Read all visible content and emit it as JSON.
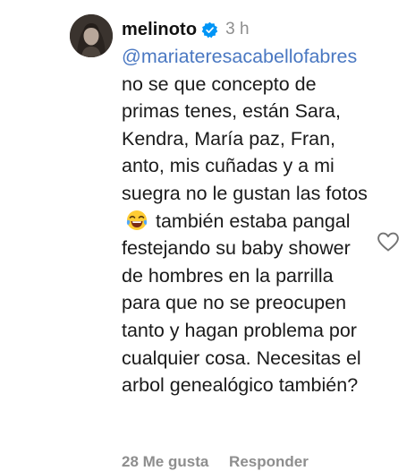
{
  "comment": {
    "username": "melinoto",
    "verified_icon": "verified-badge-icon",
    "time": "3 h",
    "mention": "@mariateresacabellofabres",
    "text_before_emoji": " no se que concepto de primas tenes, están Sara, Kendra, María paz, Fran, anto, mis cuñadas y a mi suegra no le gustan las fotos",
    "emoji_icon": "tears-of-joy-emoji",
    "text_after_emoji": " también estaba pangal festejando su baby shower de hombres en la parrilla para que no se preocupen tanto y hagan problema por cualquier cosa. Necesitas el arbol genealógico también?",
    "like_icon": "heart-outline-icon",
    "likes_label": "28 Me gusta",
    "reply_label": "Responder"
  },
  "colors": {
    "mention": "#4a78c2",
    "verified": "#0095f6",
    "muted": "#8e8e8e",
    "text": "#1a1a1a"
  }
}
